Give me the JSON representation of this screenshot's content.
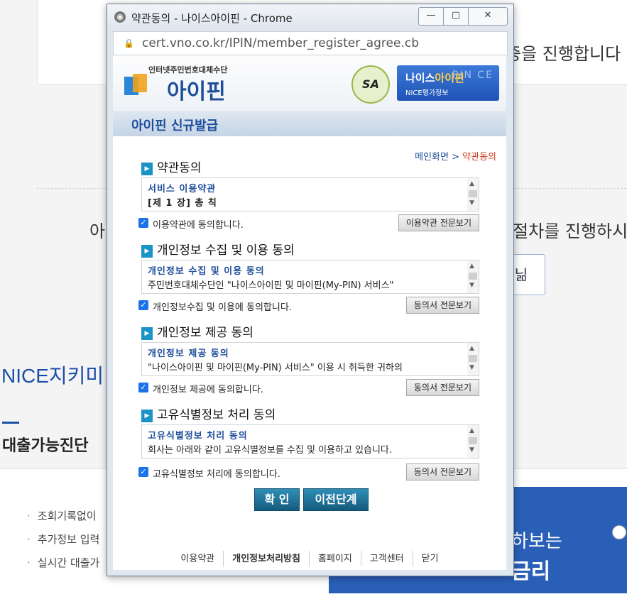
{
  "background": {
    "text_top_right": "증을 진행합니다",
    "text_mid_left": "아",
    "text_mid_right": "절차를 진행하시",
    "button_partial": "닒",
    "nice_title": "NICE지키미",
    "section_title": "대출가능진단",
    "list_items": [
      "조회기록없이",
      "추가정보 입력",
      "실시간 대출가"
    ],
    "banner_line1": "하보는",
    "banner_line2": "금리"
  },
  "window": {
    "title": "약관동의 - 나이스아이핀 - Chrome",
    "controls": [
      "—",
      "▢",
      "✕"
    ],
    "url": "cert.vno.co.kr/IPIN/member_register_agree.cb"
  },
  "header": {
    "logo_small": "인터넷주민번호대체수단",
    "logo_text": "아이핀",
    "sa_badge": "SA",
    "nice_main_prefix": "나이스",
    "nice_main_highlight": "아이핀",
    "nice_sub": "NICE평가정보",
    "nice_letters": "PIN CE",
    "section_title": "아이핀 신규발급"
  },
  "breadcrumb": {
    "home": "메인화면",
    "sep": ">",
    "current": "약관동의"
  },
  "sections": [
    {
      "heading": "약관동의",
      "box_title": "서비스 이용약관",
      "box_body": "[제 1 장] 총 칙",
      "agree_label": "이용약관에 동의합니다.",
      "button": "이용약관 전문보기"
    },
    {
      "heading": "개인정보 수집 및 이용 동의",
      "box_title": "개인정보 수집 및 이용 동의",
      "box_body": "주민번호대체수단인 \"나이스아이핀 및 마이핀(My-PIN) 서비스\"",
      "agree_label": "개인정보수집 및 이용에 동의합니다.",
      "button": "동의서 전문보기"
    },
    {
      "heading": "개인정보 제공 동의",
      "box_title": "개인정보 제공 동의",
      "box_body": "\"나이스아이핀 및 마이핀(My-PIN) 서비스\" 이용 시 취득한 귀하의",
      "agree_label": "개인정보 제공에 동의합니다.",
      "button": "동의서 전문보기"
    },
    {
      "heading": "고유식별정보 처리 동의",
      "box_title": "고유식별정보 처리 동의",
      "box_body": "회사는 아래와 같이 고유식별정보를 수집 및 이용하고 있습니다.",
      "agree_label": "고유식별정보 처리에 동의합니다.",
      "button": "동의서 전문보기"
    }
  ],
  "buttons": {
    "confirm": "확 인",
    "previous": "이전단계"
  },
  "footer": [
    "이용약관",
    "개인정보처리방침",
    "홈페이지",
    "고객센터",
    "닫기"
  ]
}
